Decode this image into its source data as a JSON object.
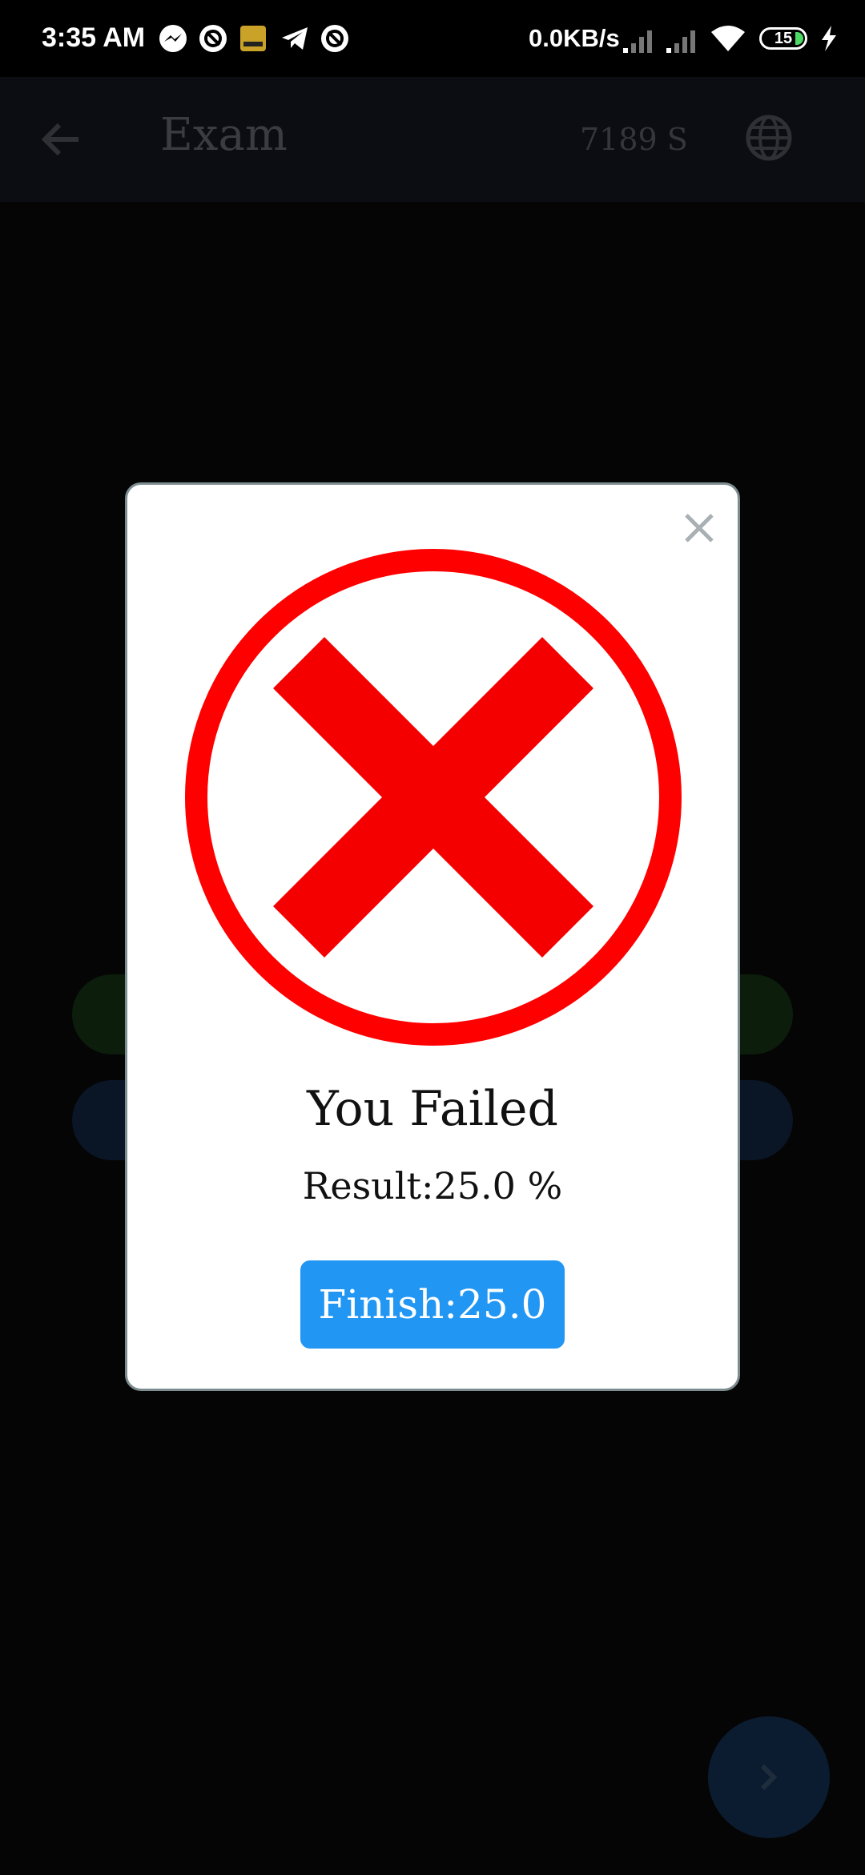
{
  "status_bar": {
    "time": "3:35 AM",
    "network_speed": "0.0KB/s",
    "battery_level": "15",
    "icons": [
      "messenger-icon",
      "vpn-icon",
      "game-icon",
      "telegram-icon",
      "vpn-icon",
      "signal-icon",
      "signal-icon",
      "wifi-icon",
      "battery-icon",
      "charging-icon"
    ]
  },
  "app_bar": {
    "title": "Exam",
    "timer": "7189 S",
    "icons": [
      "back-arrow-icon",
      "globe-icon"
    ]
  },
  "dialog": {
    "title": "You Failed",
    "result": "Result:25.0 %",
    "finish_label": "Finish:25.0",
    "icon": "fail-x-circle-icon",
    "accent_color": "#ff0000",
    "button_color": "#2196f3"
  }
}
